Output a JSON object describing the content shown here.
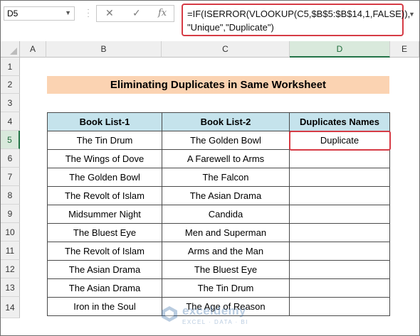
{
  "formula_bar": {
    "name_box": "D5",
    "cancel_symbol": "✕",
    "enter_symbol": "✓",
    "fx_symbol": "fx",
    "formula_line1": "=IF(ISERROR(VLOOKUP(C5,$B$5:$B$14,1,FALSE)),",
    "formula_line2": "\"Unique\",\"Duplicate\")"
  },
  "columns": [
    "A",
    "B",
    "C",
    "D",
    "E"
  ],
  "selected_column": "D",
  "rows": [
    "1",
    "2",
    "3",
    "4",
    "5",
    "6",
    "7",
    "8",
    "9",
    "10",
    "11",
    "12",
    "13",
    "14"
  ],
  "selected_row": "5",
  "sheet": {
    "title": "Eliminating Duplicates in Same Worksheet",
    "headers": [
      "Book List-1",
      "Book List-2",
      "Duplicates Names"
    ],
    "data": [
      [
        "The Tin Drum",
        "The Golden Bowl",
        "Duplicate"
      ],
      [
        "The Wings of Dove",
        "A Farewell to Arms",
        ""
      ],
      [
        "The Golden Bowl",
        "The Falcon",
        ""
      ],
      [
        "The Revolt of Islam",
        "The Asian Drama",
        ""
      ],
      [
        "Midsummer Night",
        "Candida",
        ""
      ],
      [
        "The Bluest Eye",
        "Men and Superman",
        ""
      ],
      [
        "The Revolt of Islam",
        "Arms and the Man",
        ""
      ],
      [
        "The Asian Drama",
        "The Bluest Eye",
        ""
      ],
      [
        "The Asian Drama",
        "The Tin Drum",
        ""
      ],
      [
        "Iron in the Soul",
        "The Age of Reason",
        ""
      ]
    ]
  },
  "watermark": {
    "name": "exceldemy",
    "tagline": "EXCEL · DATA · BI"
  },
  "colors": {
    "title_fill": "#fbd3b2",
    "header_fill": "#c5e3ec",
    "highlight_border": "#d63b45",
    "selection_green": "#217346"
  }
}
